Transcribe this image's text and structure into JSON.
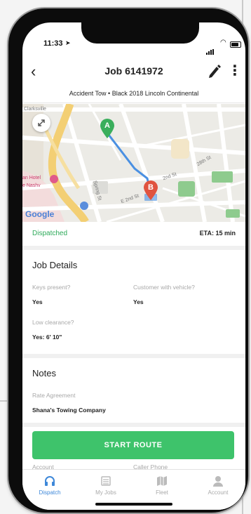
{
  "status_bar": {
    "time": "11:33",
    "location_arrow": "➤"
  },
  "header": {
    "back_icon": "chevron-left-icon",
    "title": "Job 6141972",
    "edit_icon": "pencil-icon",
    "more_icon": "⋮"
  },
  "subtitle": "Accident Tow • Black 2018 Lincoln Continental",
  "map": {
    "city_label": "Clarksville",
    "poi_label_1": "an Hotel",
    "poi_label_2": "e Nashv",
    "marker_a": "A",
    "marker_b": "B",
    "street_1": "2nd St",
    "street_2": "E 2nd St",
    "street_3": "28th St",
    "street_4": "Spring St",
    "google_logo": "Google",
    "route_color": "#4a90e2",
    "marker_a_color": "#3aae5c",
    "marker_b_color": "#e0533f"
  },
  "job_status": {
    "label": "Dispatched",
    "eta": "ETA: 15 min",
    "color": "#2eaa5a"
  },
  "job_details": {
    "title": "Job Details",
    "keys_label": "Keys present?",
    "keys_value": "Yes",
    "customer_label": "Customer with vehicle?",
    "customer_value": "Yes",
    "clearance_label": "Low clearance?",
    "clearance_value": "Yes: 6' 10\""
  },
  "notes": {
    "title": "Notes",
    "rate_label": "Rate Agreement",
    "rate_value": "Shana's Towing Company"
  },
  "start_button": {
    "label": "START ROUTE",
    "color": "#3ec36b"
  },
  "behind_labels": {
    "account": "Account",
    "caller_phone": "Caller Phone"
  },
  "tabs": [
    {
      "label": "Dispatch",
      "icon": "headset-icon",
      "active": true
    },
    {
      "label": "My Jobs",
      "icon": "list-icon",
      "active": false
    },
    {
      "label": "Fleet",
      "icon": "map-icon",
      "active": false
    },
    {
      "label": "Account",
      "icon": "user-icon",
      "active": false
    }
  ],
  "accent_color": "#3e88d9"
}
